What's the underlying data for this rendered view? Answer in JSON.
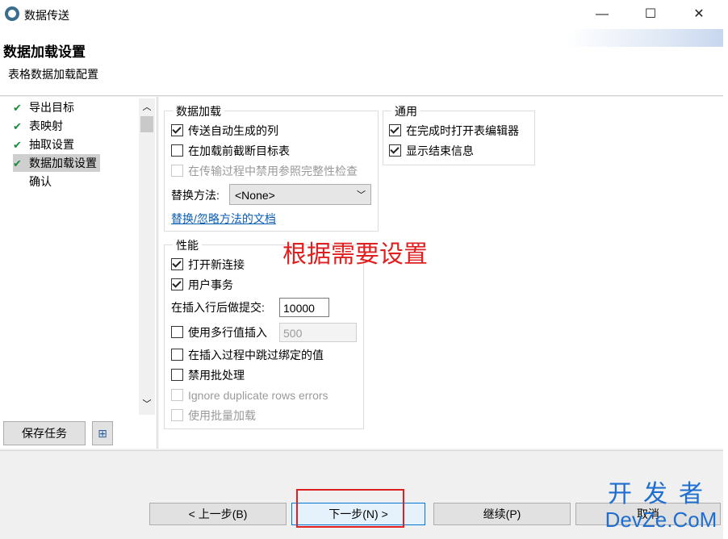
{
  "window": {
    "title": "数据传送",
    "minimize": "—",
    "maximize": "☐",
    "close": "✕"
  },
  "header": {
    "title": "数据加载设置",
    "subtitle": "表格数据加载配置"
  },
  "nav": {
    "items": [
      {
        "label": "导出目标",
        "checked": true
      },
      {
        "label": "表映射",
        "checked": true
      },
      {
        "label": "抽取设置",
        "checked": true
      },
      {
        "label": "数据加载设置",
        "checked": true,
        "selected": true
      },
      {
        "label": "确认",
        "checked": false
      }
    ],
    "save_task": "保存任务"
  },
  "data_load": {
    "title": "数据加载",
    "options": [
      {
        "label": "传送自动生成的列",
        "checked": true,
        "disabled": false
      },
      {
        "label": "在加载前截断目标表",
        "checked": false,
        "disabled": false
      },
      {
        "label": "在传输过程中禁用参照完整性检查",
        "checked": false,
        "disabled": true
      }
    ],
    "replace_label": "替换方法:",
    "replace_value": "<None>",
    "doc_link": "替换/忽略方法的文档"
  },
  "general": {
    "title": "通用",
    "options": [
      {
        "label": "在完成时打开表编辑器",
        "checked": true
      },
      {
        "label": "显示结束信息",
        "checked": true
      }
    ]
  },
  "performance": {
    "title": "性能",
    "open_new_connection": "打开新连接",
    "user_transaction": "用户事务",
    "commit_label": "在插入行后做提交:",
    "commit_value": "10000",
    "multi_row_label": "使用多行值插入",
    "multi_row_value": "500",
    "skip_bound": "在插入过程中跳过绑定的值",
    "disable_batch": "禁用批处理",
    "ignore_dup": "Ignore duplicate rows errors",
    "bulk_load": "使用批量加载"
  },
  "note": "根据需要设置",
  "footer": {
    "back": "< 上一步(B)",
    "next": "下一步(N) >",
    "continue": "继续(P)",
    "cancel": "取消"
  },
  "watermark": {
    "line1": "开发者",
    "line2": "DevZe.CoM"
  }
}
